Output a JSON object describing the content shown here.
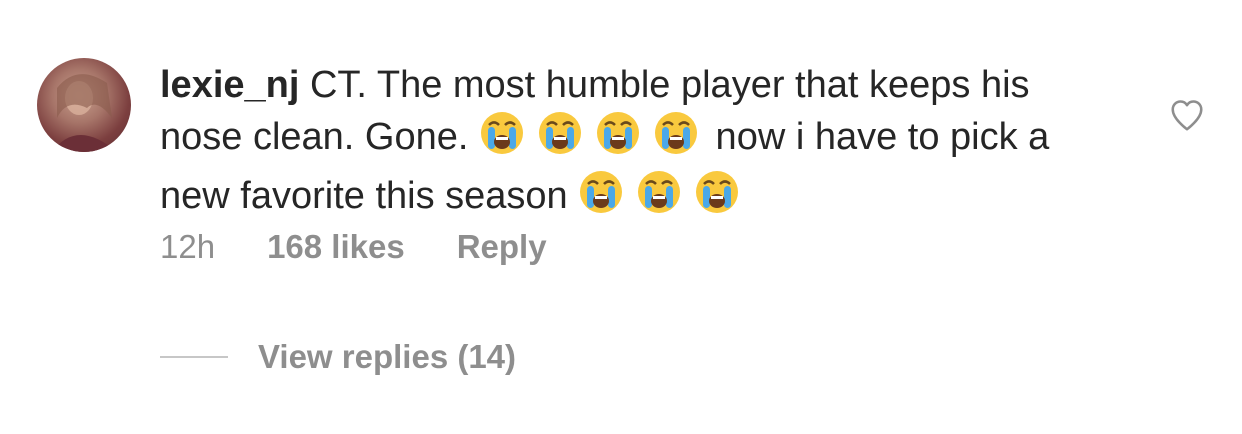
{
  "comment": {
    "username": "lexie_nj",
    "text_part1": "CT. The most humble player that keeps his nose clean. Gone. ",
    "text_part2": " now i have to pick a new favorite this season ",
    "emoji_name": "loudly-crying-face-emoji"
  },
  "meta": {
    "time": "12h",
    "likes": "168 likes",
    "reply_label": "Reply"
  },
  "replies": {
    "view_label": "View replies (14)"
  },
  "icons": {
    "heart": "heart-outline-icon"
  },
  "colors": {
    "text": "#262626",
    "secondary": "#8e8e8e"
  }
}
